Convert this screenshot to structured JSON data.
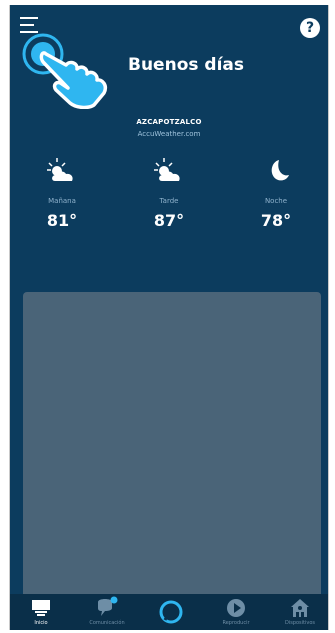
{
  "header": {
    "greeting": "Buenos días"
  },
  "weather": {
    "location": "AZCAPOTZALCO",
    "provider": "AccuWeather.com",
    "slots": [
      {
        "label": "Mañana",
        "temp": "81°",
        "icon": "partly-sunny-icon"
      },
      {
        "label": "Tarde",
        "temp": "87°",
        "icon": "partly-sunny-icon"
      },
      {
        "label": "Noche",
        "temp": "78°",
        "icon": "moon-icon"
      }
    ]
  },
  "nav": {
    "items": [
      {
        "label": "Inicio",
        "icon": "home-icon",
        "active": true
      },
      {
        "label": "Comunicación",
        "icon": "chat-icon",
        "active": false
      },
      {
        "label": "",
        "icon": "alexa-icon",
        "active": false
      },
      {
        "label": "Reproducir",
        "icon": "play-icon",
        "active": false
      },
      {
        "label": "Dispositivos",
        "icon": "devices-icon",
        "active": false
      }
    ]
  },
  "colors": {
    "background": "#0c3c5e",
    "card": "#4a6478",
    "accent": "#2fb6f0",
    "nav_background": "#0a2f49"
  }
}
